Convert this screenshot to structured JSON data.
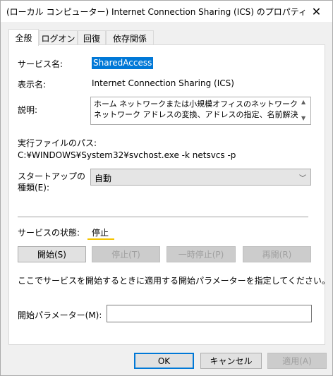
{
  "window": {
    "title": "(ローカル コンピューター) Internet Connection Sharing (ICS) のプロパティ",
    "close_glyph": "✕"
  },
  "tabs": [
    {
      "label": "全般",
      "active": true
    },
    {
      "label": "ログオン",
      "active": false
    },
    {
      "label": "回復",
      "active": false
    },
    {
      "label": "依存関係",
      "active": false
    }
  ],
  "general": {
    "service_name_label": "サービス名:",
    "service_name_value": "SharedAccess",
    "display_name_label": "表示名:",
    "display_name_value": "Internet Connection Sharing (ICS)",
    "description_label": "説明:",
    "description_line1": "ホーム ネットワークまたは小規模オフィスのネットワークに対して",
    "description_line2": "ネットワーク アドレスの変換、アドレスの指定、名前解決、およ",
    "scroll_up": "▲",
    "scroll_down": "▼",
    "exe_path_label": "実行ファイルのパス:",
    "exe_path_value": "C:¥WINDOWS¥System32¥svchost.exe -k netsvcs -p",
    "startup_type_label_line1": "スタートアップの",
    "startup_type_label_line2": "種類(E):",
    "startup_type_value": "自動",
    "startup_type_arrow": "﹀",
    "service_status_label": "サービスの状態:",
    "service_status_value": "停止",
    "start_button": "開始(S)",
    "stop_button": "停止(T)",
    "pause_button": "一時停止(P)",
    "resume_button": "再開(R)",
    "hint_text": "ここでサービスを開始するときに適用する開始パラメーターを指定してください。",
    "start_params_label": "開始パラメーター(M):",
    "start_params_value": ""
  },
  "footer": {
    "ok_button": "OK",
    "cancel_button": "キャンセル",
    "apply_button": "適用(A)"
  },
  "colors": {
    "selection": "#0078d7",
    "status_highlight": "#f5c400",
    "disabled_text": "#a0a0a0"
  }
}
